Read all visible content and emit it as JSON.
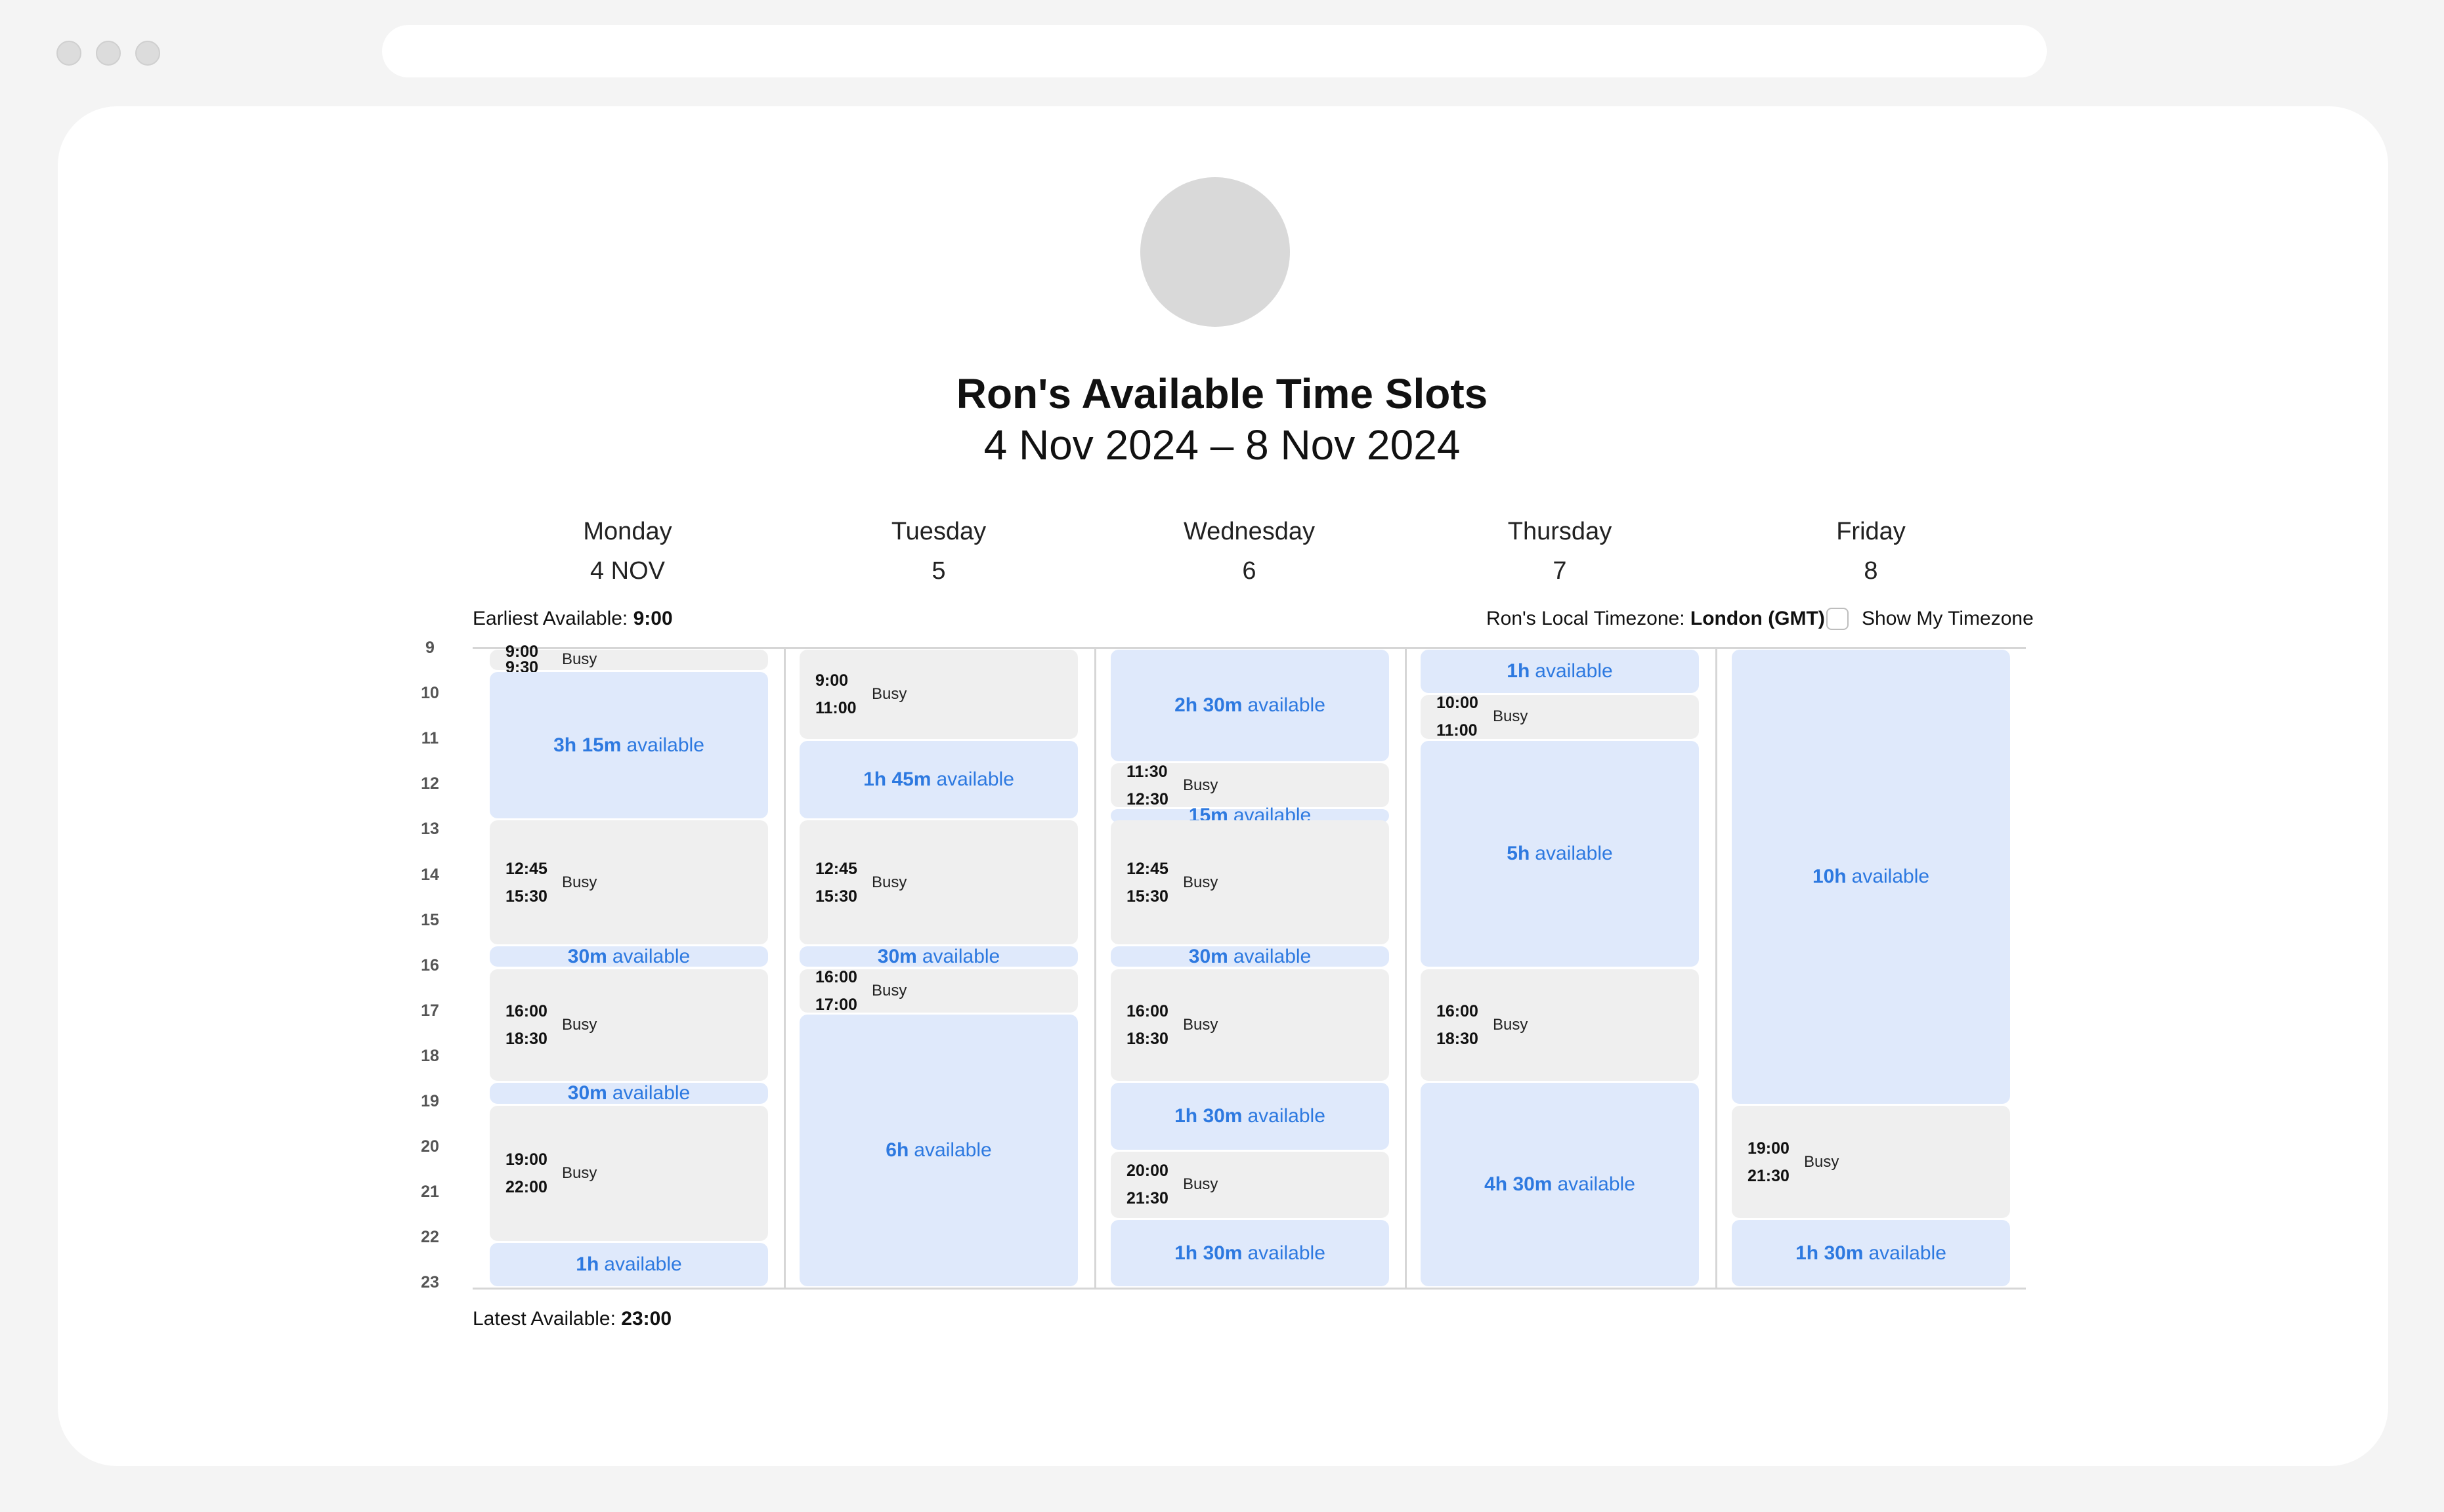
{
  "window": {
    "url": ""
  },
  "header": {
    "title": "Ron's Available Time Slots",
    "date_range": "4 Nov 2024 – 8 Nov 2024"
  },
  "days": [
    {
      "name": "Monday",
      "date": "4 NOV"
    },
    {
      "name": "Tuesday",
      "date": "5"
    },
    {
      "name": "Wednesday",
      "date": "6"
    },
    {
      "name": "Thursday",
      "date": "7"
    },
    {
      "name": "Friday",
      "date": "8"
    }
  ],
  "meta": {
    "earliest_label": "Earliest Available:",
    "earliest_value": "9:00",
    "latest_label": "Latest Available:",
    "latest_value": "23:00",
    "timezone_label": "Ron's Local Timezone:",
    "timezone_value": "London (GMT)",
    "show_my_timezone": "Show My Timezone",
    "show_my_timezone_checked": false
  },
  "hours": [
    "9",
    "10",
    "11",
    "12",
    "13",
    "14",
    "15",
    "16",
    "17",
    "18",
    "19",
    "20",
    "21",
    "22",
    "23"
  ],
  "available_word": "available",
  "busy_word": "Busy",
  "slots": [
    [
      {
        "type": "busy",
        "start": "9:00",
        "end": "9:30"
      },
      {
        "type": "available",
        "start": "9:30",
        "end": "12:45",
        "duration": "3h 15m"
      },
      {
        "type": "busy",
        "start": "12:45",
        "end": "15:30"
      },
      {
        "type": "available",
        "start": "15:30",
        "end": "16:00",
        "duration": "30m"
      },
      {
        "type": "busy",
        "start": "16:00",
        "end": "18:30"
      },
      {
        "type": "available",
        "start": "18:30",
        "end": "19:00",
        "duration": "30m"
      },
      {
        "type": "busy",
        "start": "19:00",
        "end": "22:00"
      },
      {
        "type": "available",
        "start": "22:00",
        "end": "23:00",
        "duration": "1h"
      }
    ],
    [
      {
        "type": "busy",
        "start": "9:00",
        "end": "11:00"
      },
      {
        "type": "available",
        "start": "11:00",
        "end": "12:45",
        "duration": "1h 45m"
      },
      {
        "type": "busy",
        "start": "12:45",
        "end": "15:30"
      },
      {
        "type": "available",
        "start": "15:30",
        "end": "16:00",
        "duration": "30m"
      },
      {
        "type": "busy",
        "start": "16:00",
        "end": "17:00"
      },
      {
        "type": "available",
        "start": "17:00",
        "end": "23:00",
        "duration": "6h"
      }
    ],
    [
      {
        "type": "available",
        "start": "9:00",
        "end": "11:30",
        "duration": "2h 30m"
      },
      {
        "type": "busy",
        "start": "11:30",
        "end": "12:30"
      },
      {
        "type": "available",
        "start": "12:30",
        "end": "12:45",
        "duration": "15m"
      },
      {
        "type": "busy",
        "start": "12:45",
        "end": "15:30"
      },
      {
        "type": "available",
        "start": "15:30",
        "end": "16:00",
        "duration": "30m"
      },
      {
        "type": "busy",
        "start": "16:00",
        "end": "18:30"
      },
      {
        "type": "available",
        "start": "18:30",
        "end": "20:00",
        "duration": "1h 30m"
      },
      {
        "type": "busy",
        "start": "20:00",
        "end": "21:30"
      },
      {
        "type": "available",
        "start": "21:30",
        "end": "23:00",
        "duration": "1h 30m"
      }
    ],
    [
      {
        "type": "available",
        "start": "9:00",
        "end": "10:00",
        "duration": "1h"
      },
      {
        "type": "busy",
        "start": "10:00",
        "end": "11:00"
      },
      {
        "type": "available",
        "start": "11:00",
        "end": "16:00",
        "duration": "5h"
      },
      {
        "type": "busy",
        "start": "16:00",
        "end": "18:30"
      },
      {
        "type": "available",
        "start": "18:30",
        "end": "23:00",
        "duration": "4h 30m"
      }
    ],
    [
      {
        "type": "available",
        "start": "9:00",
        "end": "19:00",
        "duration": "10h"
      },
      {
        "type": "busy",
        "start": "19:00",
        "end": "21:30"
      },
      {
        "type": "available",
        "start": "21:30",
        "end": "23:00",
        "duration": "1h 30m"
      }
    ]
  ],
  "colors": {
    "available_bg": "#dfe9fb",
    "available_text": "#2d79e0",
    "busy_bg": "#efefef"
  }
}
